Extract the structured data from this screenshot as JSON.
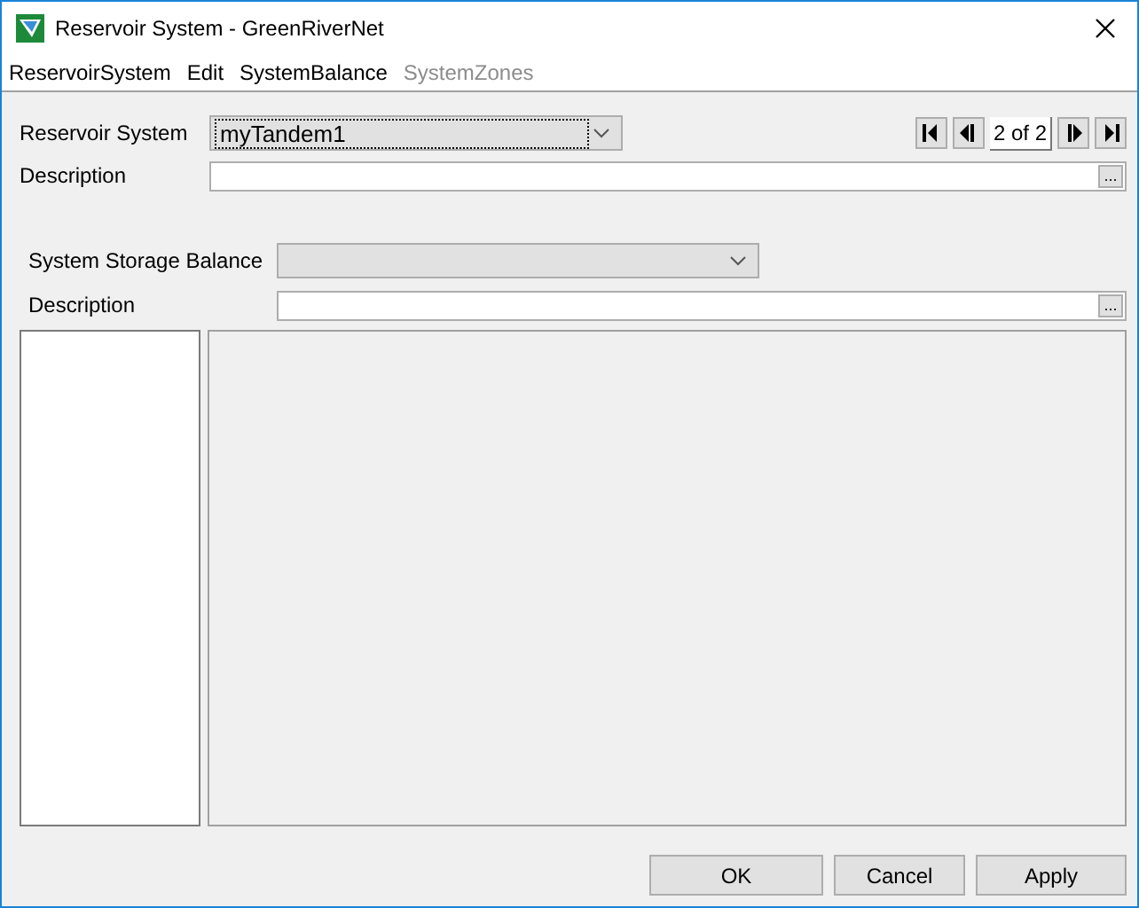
{
  "window": {
    "title": "Reservoir System - GreenRiverNet"
  },
  "menu": [
    {
      "label": "ReservoirSystem",
      "disabled": false
    },
    {
      "label": "Edit",
      "disabled": false
    },
    {
      "label": "SystemBalance",
      "disabled": false
    },
    {
      "label": "SystemZones",
      "disabled": true
    }
  ],
  "reservoir_system": {
    "label": "Reservoir System",
    "value": "myTandem1"
  },
  "navigator": {
    "position": "2 of 2"
  },
  "description": {
    "label": "Description",
    "browse": "..."
  },
  "storage_balance": {
    "label": "System Storage Balance"
  },
  "balance_description": {
    "label": "Description",
    "browse": "..."
  },
  "buttons": [
    "OK",
    "Cancel",
    "Apply"
  ]
}
